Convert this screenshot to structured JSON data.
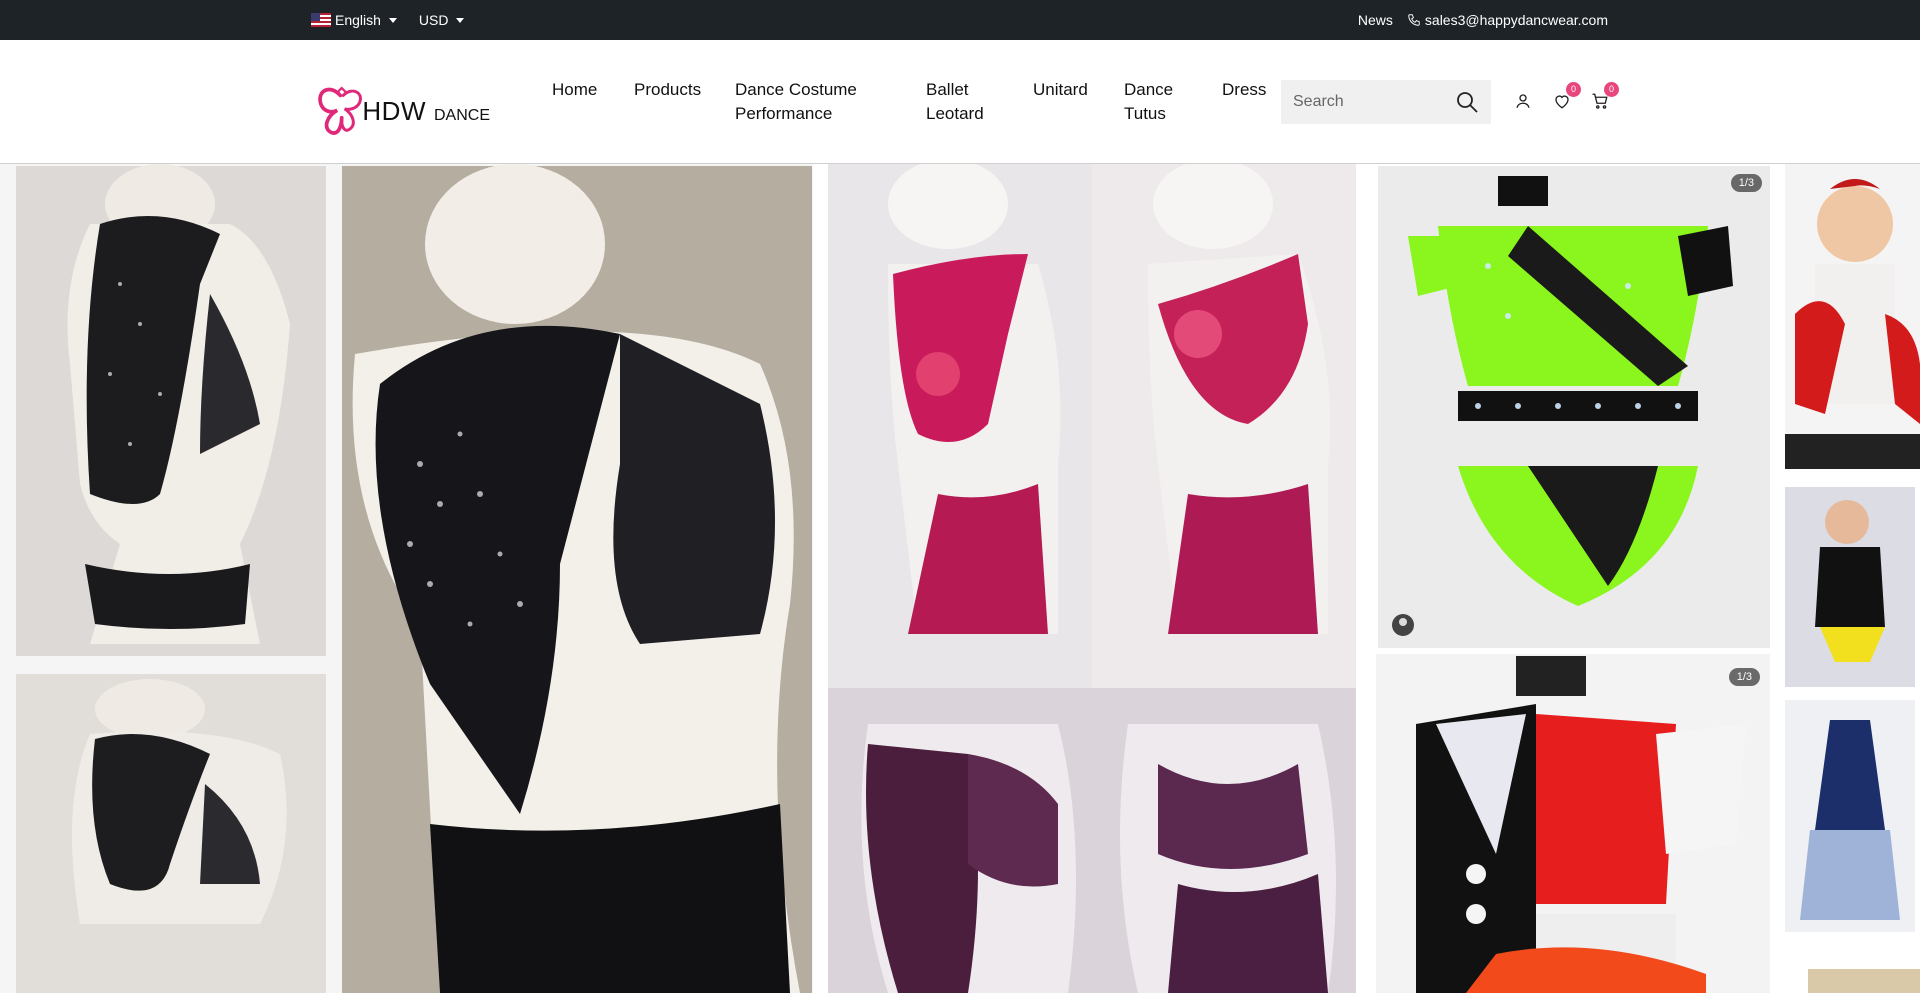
{
  "topbar": {
    "language": "English",
    "currency": "USD",
    "news": "News",
    "email": "sales3@happydancwear.com"
  },
  "header": {
    "logo_text": "HDW",
    "logo_sub": "DANCE",
    "nav": [
      "Home",
      "Products",
      "Dance Costume Performance",
      "Ballet Leotard",
      "Unitard",
      "Dance Tutus",
      "Dress"
    ],
    "search_placeholder": "Search",
    "wishlist_count": "0",
    "cart_count": "0"
  },
  "gallery": {
    "counter_1": "1/3",
    "counter_2": "1/3"
  },
  "colors": {
    "topbar_bg": "#1e2327",
    "brand_pink": "#e0287a",
    "badge": "#e8467c"
  },
  "icons": [
    "flag-us-icon",
    "chevron-down-icon",
    "phone-icon",
    "search-icon",
    "user-icon",
    "heart-icon",
    "cart-icon",
    "avatar-icon"
  ]
}
